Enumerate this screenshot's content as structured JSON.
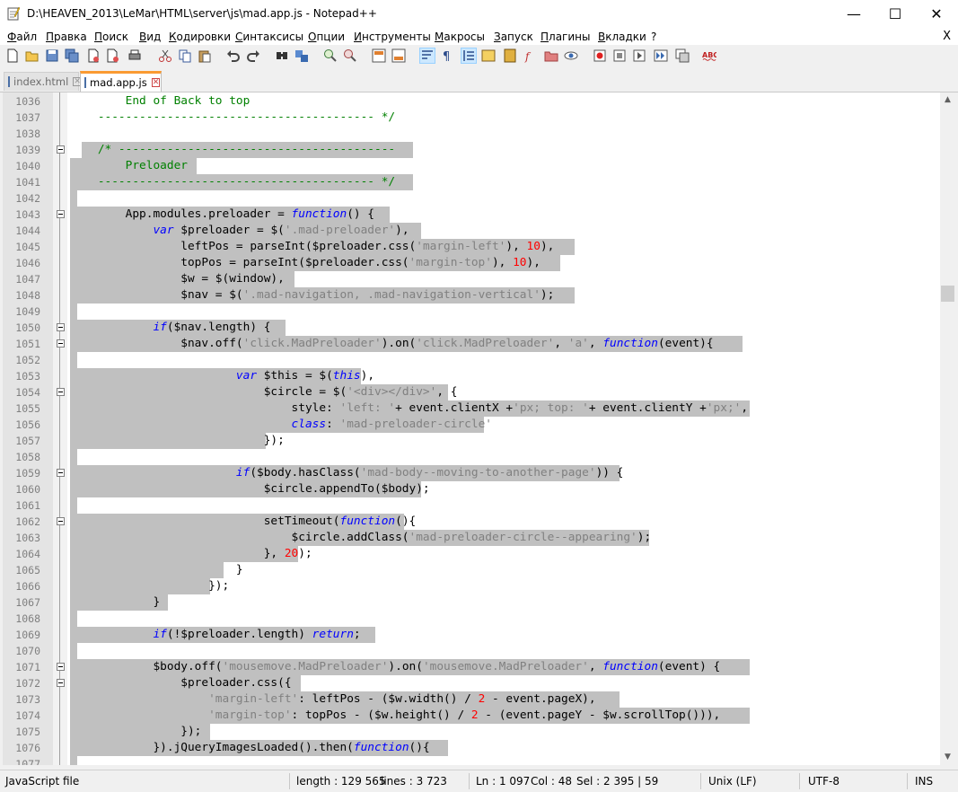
{
  "window": {
    "title": "D:\\HEAVEN_2013\\LeMar\\HTML\\server\\js\\mad.app.js - Notepad++",
    "minimize": "—",
    "maximize": "☐",
    "close": "✕"
  },
  "menu": {
    "items": [
      "Файл",
      "Правка",
      "Поиск",
      "Вид",
      "Кодировки",
      "Синтаксисы",
      "Опции",
      "Инструменты",
      "Макросы",
      "Запуск",
      "Плагины",
      "Вкладки",
      "?"
    ],
    "close": "X"
  },
  "tabs": [
    {
      "label": "index.html",
      "active": false
    },
    {
      "label": "mad.app.js",
      "active": true
    }
  ],
  "editor": {
    "lines": [
      {
        "n": "1036"
      },
      {
        "n": "1037"
      },
      {
        "n": "1038"
      },
      {
        "n": "1039"
      },
      {
        "n": "1040"
      },
      {
        "n": "1041"
      },
      {
        "n": "1042"
      },
      {
        "n": "1043"
      },
      {
        "n": "1044"
      },
      {
        "n": "1045"
      },
      {
        "n": "1046"
      },
      {
        "n": "1047"
      },
      {
        "n": "1048"
      },
      {
        "n": "1049"
      },
      {
        "n": "1050"
      },
      {
        "n": "1051"
      },
      {
        "n": "1052"
      },
      {
        "n": "1053"
      },
      {
        "n": "1054"
      },
      {
        "n": "1055"
      },
      {
        "n": "1056"
      },
      {
        "n": "1057"
      },
      {
        "n": "1058"
      },
      {
        "n": "1059"
      },
      {
        "n": "1060"
      },
      {
        "n": "1061"
      },
      {
        "n": "1062"
      },
      {
        "n": "1063"
      },
      {
        "n": "1064"
      },
      {
        "n": "1065"
      },
      {
        "n": "1066"
      },
      {
        "n": "1067"
      },
      {
        "n": "1068"
      },
      {
        "n": "1069"
      },
      {
        "n": "1070"
      },
      {
        "n": "1071"
      },
      {
        "n": "1072"
      },
      {
        "n": "1073"
      },
      {
        "n": "1074"
      },
      {
        "n": "1075"
      },
      {
        "n": "1076"
      },
      {
        "n": "1077"
      }
    ]
  },
  "status": {
    "filetype": "JavaScript file",
    "length": "length : 129 565",
    "lines": "lines : 3 723",
    "ln": "Ln : 1 097",
    "col": "Col : 48",
    "sel": "Sel : 2 395 | 59",
    "eol": "Unix (LF)",
    "encoding": "UTF-8",
    "mode": "INS"
  }
}
